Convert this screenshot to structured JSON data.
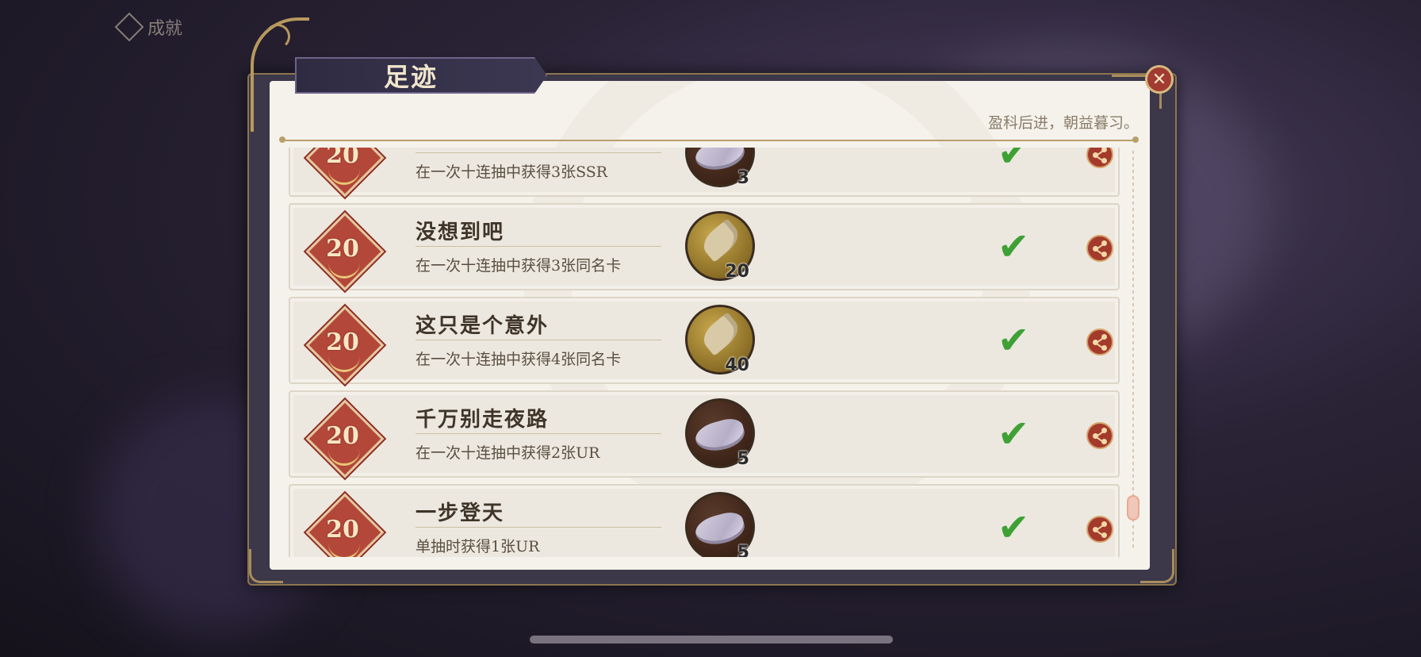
{
  "header": {
    "top_label": "成就",
    "title": "足迹",
    "subtitle": "盈科后进，朝益暮习。",
    "close_label": "✕"
  },
  "achievements": [
    {
      "badge": "20",
      "title": "",
      "desc": "在一次十连抽中获得3张SSR",
      "reward_type": "shell",
      "reward_count": "3",
      "completed": true
    },
    {
      "badge": "20",
      "title": "没想到吧",
      "desc": "在一次十连抽中获得3张同名卡",
      "reward_type": "feather",
      "reward_count": "20",
      "completed": true
    },
    {
      "badge": "20",
      "title": "这只是个意外",
      "desc": "在一次十连抽中获得4张同名卡",
      "reward_type": "feather",
      "reward_count": "40",
      "completed": true
    },
    {
      "badge": "20",
      "title": "千万别走夜路",
      "desc": "在一次十连抽中获得2张UR",
      "reward_type": "shell",
      "reward_count": "5",
      "completed": true
    },
    {
      "badge": "20",
      "title": "一步登天",
      "desc": "单抽时获得1张UR",
      "reward_type": "shell",
      "reward_count": "5",
      "completed": true
    }
  ],
  "icons": {
    "check": "check-icon",
    "share": "share-icon",
    "close": "close-icon"
  },
  "colors": {
    "accent_red": "#a33a2c",
    "gold": "#b99f6b",
    "check_green": "#3fa135"
  }
}
